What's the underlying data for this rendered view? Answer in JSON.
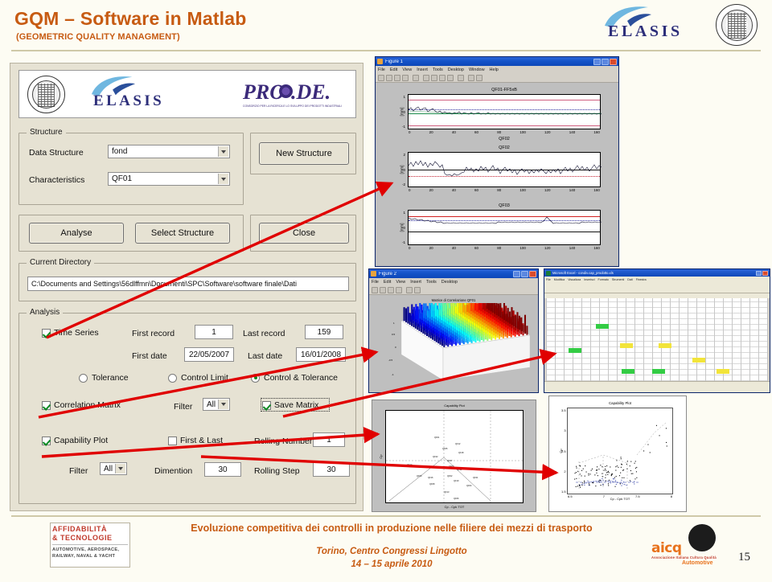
{
  "slide": {
    "title": "GQM – Software in Matlab",
    "subtitle": "(GEOMETRIC QUALITY MANAGMENT)",
    "page_number": "15",
    "accent_color": "#C75B12",
    "background_color": "#fdfcf3"
  },
  "branding": {
    "elasis_word": "ELASIS",
    "prode_word": "PRO",
    "prode_word2": ".DE.",
    "prode_tagline": "CONSORZIO PER LA RICERCA E LO SVILUPPO DEI PRODOTTI INDUSTRIALI",
    "seal_name": "university-of-naples-federico-ii-seal"
  },
  "gui": {
    "structure_group": {
      "legend": "Structure",
      "data_structure_label": "Data Structure",
      "data_structure_value": "fond",
      "characteristics_label": "Characteristics",
      "characteristics_value": "QF01",
      "new_structure_button": "New Structure",
      "analyse_button": "Analyse",
      "select_structure_button": "Select Structure",
      "close_button": "Close"
    },
    "current_directory": {
      "legend": "Current  Directory",
      "path": "C:\\Documents and Settings\\56dlffmn\\Documenti\\SPC\\Software\\software finale\\Dati"
    },
    "analysis": {
      "legend": "Analysis",
      "time_series_label": "Time Series",
      "time_series_checked": true,
      "first_record_label": "First record",
      "first_record_value": "1",
      "last_record_label": "Last record",
      "last_record_value": "159",
      "first_date_label": "First date",
      "first_date_value": "22/05/2007",
      "last_date_label": "Last date",
      "last_date_value": "16/01/2008",
      "radio_tolerance": "Tolerance",
      "radio_control_limit": "Control Limit",
      "radio_control_tolerance": "Control & Tolerance",
      "radio_selected": "Control & Tolerance",
      "correlation_matrix_label": "Correlation Matrix",
      "correlation_matrix_checked": true,
      "corr_filter_label": "Filter",
      "corr_filter_value": "All",
      "save_matrix_label": "Save Matrix",
      "save_matrix_checked": true,
      "capability_plot_label": "Capability Plot",
      "capability_plot_checked": true,
      "first_last_label": "First & Last",
      "first_last_checked": false,
      "rolling_number_label": "Rolling Number",
      "rolling_number_value": "1",
      "cap_filter_label": "Filter",
      "cap_filter_value": "All",
      "dimention_label": "Dimention",
      "dimention_value": "30",
      "rolling_step_label": "Rolling Step",
      "rolling_step_value": "30"
    }
  },
  "figure_window": {
    "title": "Figure 1",
    "menu": [
      "File",
      "Edit",
      "View",
      "Insert",
      "Tools",
      "Desktop",
      "Window",
      "Help"
    ]
  },
  "figure3d_window": {
    "title": "Figure 2"
  },
  "excel_window": {
    "title": "Microsoft Excel - condiv.cap_prodotto.xls"
  },
  "chart_data": [
    {
      "type": "line",
      "title": "QF01-FF5xB",
      "xlabel": "QF02",
      "ylabel": "[mm]",
      "xlim": [
        0,
        160
      ],
      "ylim": [
        -1,
        1
      ],
      "xticks": [
        "0",
        "20",
        "40",
        "60",
        "80",
        "100",
        "120",
        "140",
        "160"
      ],
      "yticks": [
        "1",
        "0",
        "-1"
      ],
      "grid": false,
      "limit_lines": {
        "usl": 0.72,
        "lsl": -0.72,
        "ucl": 0.28,
        "lcl": -0.1,
        "center": 0.05
      },
      "series": [
        {
          "name": "measurement",
          "n_points": 159,
          "mean": 0.08,
          "std": 0.09
        }
      ]
    },
    {
      "type": "line",
      "title": "QF02",
      "xlabel": "",
      "ylabel": "[mm]",
      "xlim": [
        0,
        160
      ],
      "ylim": [
        -2,
        2
      ],
      "xticks": [
        "0",
        "20",
        "40",
        "60",
        "80",
        "100",
        "120",
        "140",
        "160"
      ],
      "yticks": [
        "2",
        "0",
        "-2"
      ],
      "grid": false,
      "limit_lines": {
        "usl": 1.0,
        "lsl": -1.0,
        "ucl": 0.35,
        "lcl": -0.35,
        "center": 0.0
      },
      "series": [
        {
          "name": "measurement",
          "n_points": 159,
          "mean": 0.05,
          "std": 0.3
        }
      ]
    },
    {
      "type": "line",
      "title": "QF03",
      "xlabel": "",
      "ylabel": "[mm]",
      "xlim": [
        0,
        160
      ],
      "ylim": [
        -1,
        1
      ],
      "xticks": [
        "0",
        "20",
        "40",
        "60",
        "80",
        "100",
        "120",
        "140",
        "160"
      ],
      "yticks": [
        "1",
        "0",
        "-1"
      ],
      "grid": false,
      "limit_lines": {
        "usl": 0.62,
        "lsl": -0.62,
        "ucl": 0.55,
        "center": 0.4
      },
      "series": [
        {
          "name": "measurement",
          "n_points": 159,
          "mean": 0.38,
          "std": 0.1
        }
      ]
    },
    {
      "type": "bar",
      "title": "Matrice di Correlazione QF01",
      "render": "3d-bar-matrix",
      "colormap": "jet",
      "xlabel": "",
      "ylabel": "",
      "zlabel": "",
      "zticks": [
        "1",
        "0.5",
        "0",
        "-0.5",
        "-1"
      ],
      "n_rows": 22,
      "n_cols": 22
    },
    {
      "type": "scatter",
      "title": "Capability Plot",
      "xlabel": "Cp - Cpk TOT",
      "ylabel": "Cp",
      "grid": false,
      "n_points": 40
    },
    {
      "type": "scatter",
      "title": "Capability Plot",
      "xlabel": "Cp - Cpk TOT",
      "ylabel": "Cp",
      "xlim": [
        6,
        8
      ],
      "ylim": [
        1.5,
        3.5
      ],
      "xticks": [
        "6.5",
        "7",
        "7.5",
        "8"
      ],
      "yticks": [
        "1.5",
        "2",
        "2.5",
        "3",
        "3.5"
      ],
      "grid": false,
      "n_points": 120
    }
  ],
  "footer": {
    "line1": "Evoluzione competitiva dei controlli in produzione nelle filiere dei mezzi di trasporto",
    "line2": "Torino, Centro Congressi Lingotto",
    "line3": "14 – 15 aprile 2010",
    "affidabilita_1": "AFFIDABILITÀ",
    "affidabilita_2": "& TECNOLOGIE",
    "affidabilita_3": "AUTOMOTIVE, AEROSPACE,\nRAILWAY, NAVAL & YACHT",
    "aicq_word": "aicq",
    "aicq_sub": "Associazione Italiana Cultura Qualità",
    "aicq_sub2": "Automotive"
  }
}
